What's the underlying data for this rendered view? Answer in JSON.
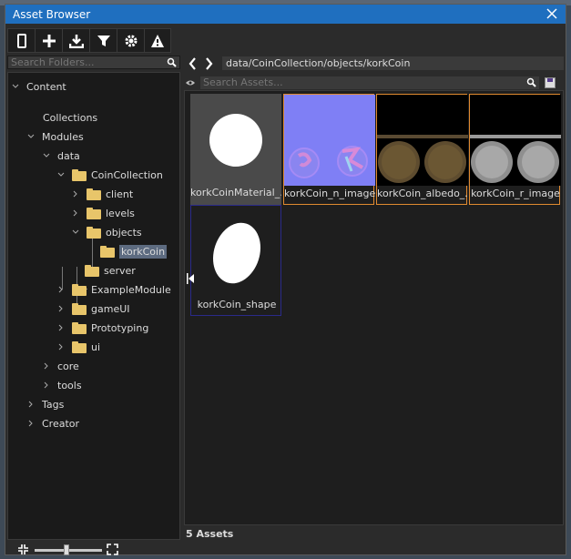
{
  "window": {
    "title": "Asset Browser"
  },
  "toolbar": {
    "buttons": [
      "phone-icon",
      "plus-icon",
      "import-icon",
      "filter-icon",
      "gear-icon",
      "warning-icon"
    ]
  },
  "folders": {
    "search_placeholder": "Search Folders...",
    "tree": {
      "content": "Content",
      "collections": "Collections",
      "modules": "Modules",
      "data": "data",
      "coincollection": "CoinCollection",
      "client": "client",
      "levels": "levels",
      "objects": "objects",
      "korkcoin": "korkCoin",
      "server": "server",
      "examplemodule": "ExampleModule",
      "gameui": "gameUI",
      "prototyping": "Prototyping",
      "ui": "ui",
      "core": "core",
      "tools": "tools",
      "tags": "Tags",
      "creator": "Creator"
    }
  },
  "assets": {
    "path": "data/CoinCollection/objects/korkCoin",
    "search_placeholder": "Search Assets...",
    "items": [
      {
        "label": "korkCoinMaterial_..."
      },
      {
        "label": "korkCoin_n_image"
      },
      {
        "label": "korkCoin_albedo_..."
      },
      {
        "label": "korkCoin_r_image"
      },
      {
        "label": "korkCoin_shape"
      }
    ],
    "status": "5 Assets"
  },
  "colors": {
    "accent": "#1f6fbf",
    "selection": "#5d6b80",
    "image_border": "#e08a30",
    "shape_border": "#2a2a8a"
  }
}
